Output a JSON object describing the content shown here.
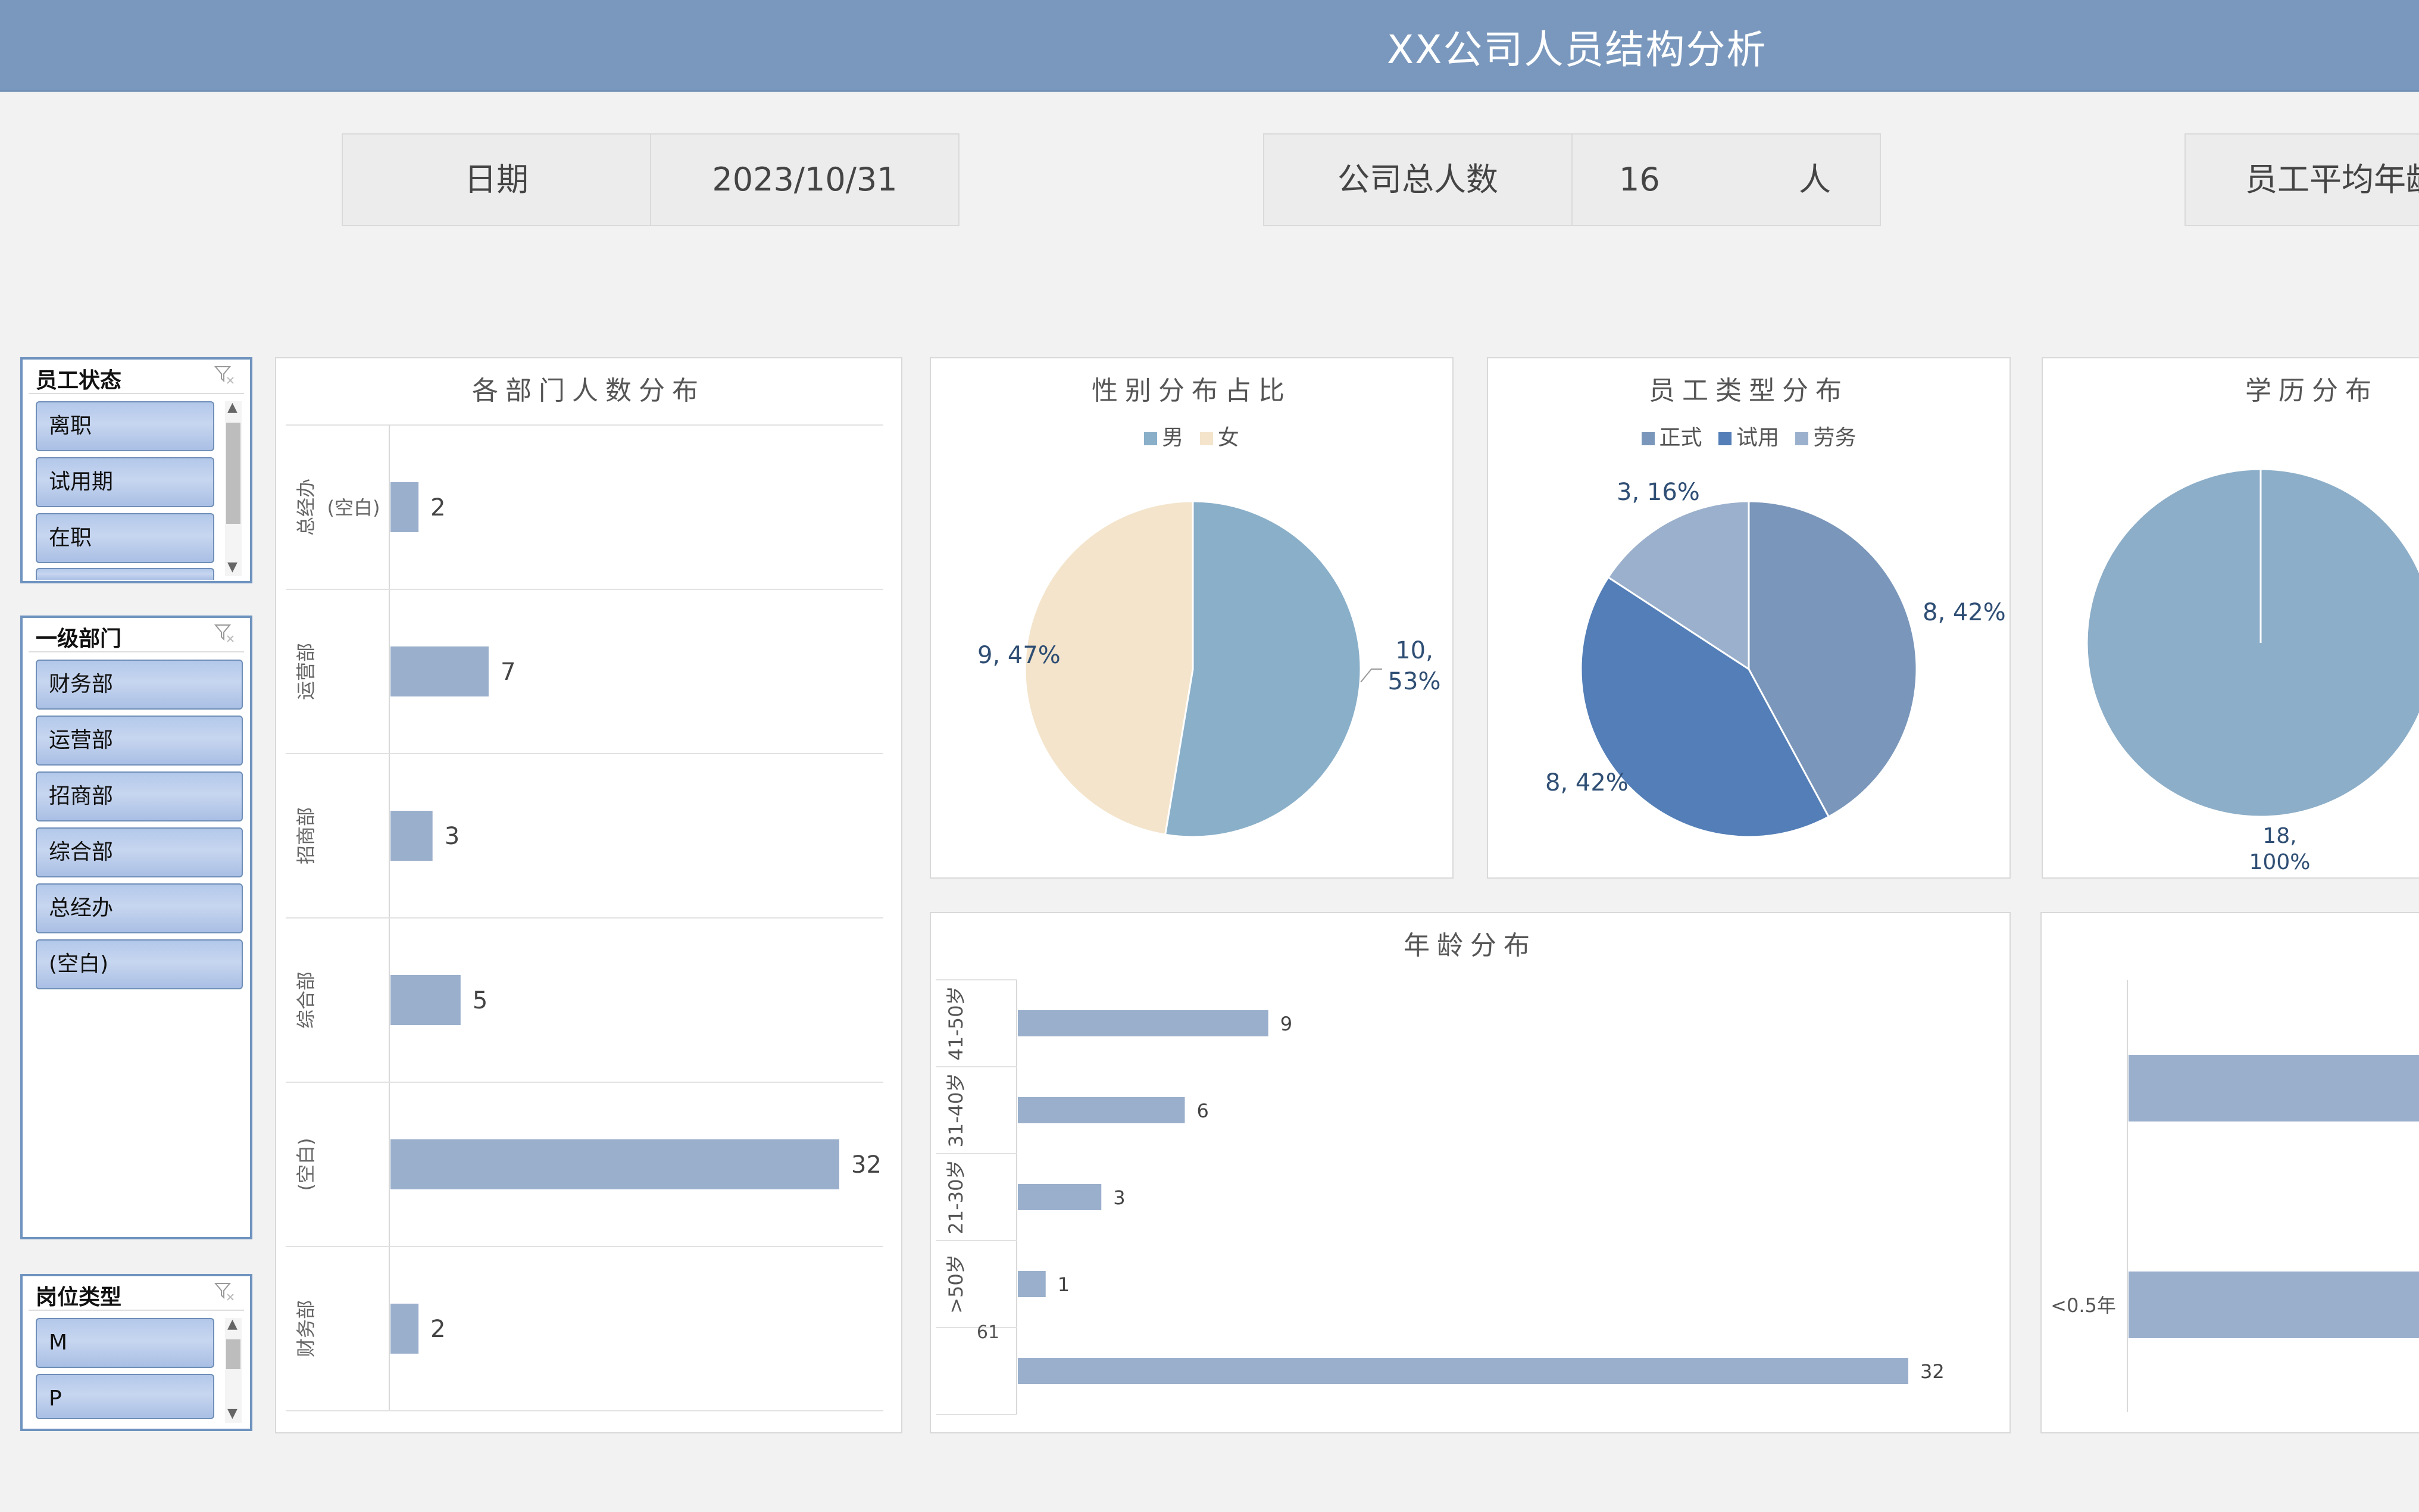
{
  "header": {
    "title": "XX公司人员结构分析"
  },
  "kpis": {
    "date_label": "日期",
    "date_value": "2023/10/31",
    "total_label": "公司总人数",
    "total_value": "16",
    "total_unit": "人",
    "avg_age_label": "员工平均年龄"
  },
  "slicers": [
    {
      "title": "员工状态",
      "items": [
        "离职",
        "试用期",
        "在职"
      ]
    },
    {
      "title": "一级部门",
      "items": [
        "财务部",
        "运营部",
        "招商部",
        "综合部",
        "总经办",
        "(空白)"
      ]
    },
    {
      "title": "岗位类型",
      "items": [
        "M",
        "P"
      ]
    }
  ],
  "colors": {
    "bar": "#9aafcc",
    "male": "#8aafc9",
    "female": "#f3e4cb",
    "formal": "#7a96ba",
    "trial": "#537eb7",
    "labor": "#9bb0cc",
    "edu": "#8daec8"
  },
  "chart_data": [
    {
      "type": "bar",
      "title": "各部门人数分布",
      "orientation": "horizontal",
      "categories": [
        {
          "outer": "总经办",
          "inner": "(空白)"
        },
        {
          "outer": "运营部",
          "inner": ""
        },
        {
          "outer": "招商部",
          "inner": ""
        },
        {
          "outer": "综合部",
          "inner": ""
        },
        {
          "outer": "(空白)",
          "inner": ""
        },
        {
          "outer": "财务部",
          "inner": ""
        }
      ],
      "values": [
        2,
        7,
        3,
        5,
        32,
        2
      ],
      "value_labels": [
        "2",
        "7",
        "3",
        "5",
        "32",
        "2"
      ],
      "xlim": [
        0,
        34
      ]
    },
    {
      "type": "pie",
      "title": "性别分布占比",
      "legend": [
        "男",
        "女"
      ],
      "values": [
        10,
        9
      ],
      "labels": [
        "10,",
        "9, 47%"
      ],
      "label_extra": "53%"
    },
    {
      "type": "pie",
      "title": "员工类型分布",
      "legend": [
        "正式",
        "试用",
        "劳务"
      ],
      "values": [
        8,
        8,
        3
      ],
      "labels": [
        "8, 42%",
        "8, 42%",
        "3, 16%"
      ]
    },
    {
      "type": "pie",
      "title": "学历分布",
      "values": [
        18
      ],
      "labels": [
        "18,"
      ],
      "label_extra": "100%"
    },
    {
      "type": "bar",
      "title": "年龄分布",
      "orientation": "horizontal",
      "categories": [
        "41-50岁",
        "31-40岁",
        "21-30岁",
        ">50岁",
        ""
      ],
      "inner_label": "61",
      "values": [
        9,
        6,
        3,
        1,
        32
      ],
      "value_labels": [
        "9",
        "6",
        "3",
        "1",
        "32"
      ],
      "xlim": [
        0,
        34
      ]
    },
    {
      "type": "bar",
      "orientation": "horizontal",
      "categories": [
        "",
        "<0.5年"
      ],
      "note": "partially visible, cut off at right edge"
    }
  ]
}
